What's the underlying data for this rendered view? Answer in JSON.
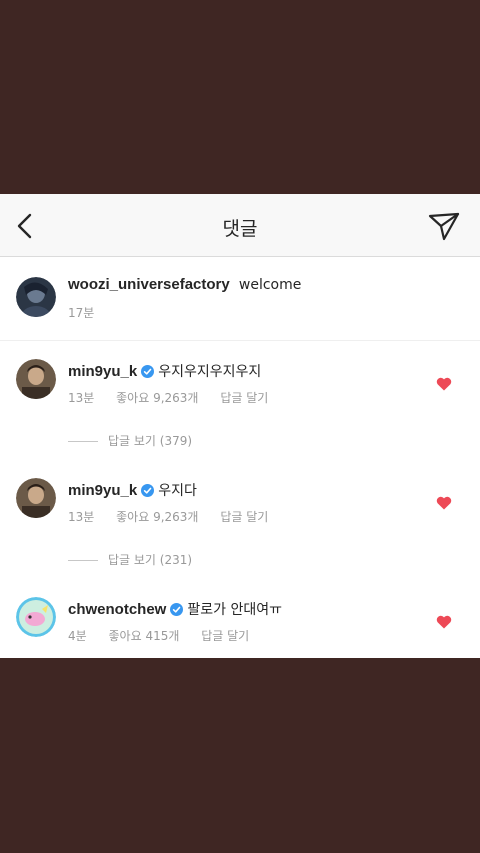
{
  "header": {
    "title": "댓글"
  },
  "caption": {
    "username": "woozi_universefactory",
    "text": "welcome",
    "time": "17분"
  },
  "comments": [
    {
      "username": "min9yu_k",
      "verified": true,
      "text": "우지우지우지우지",
      "time": "13분",
      "likes": "좋아요 9,263개",
      "reply_label": "답글 달기",
      "view_replies": "답글 보기 (379)"
    },
    {
      "username": "min9yu_k",
      "verified": true,
      "text": "우지다",
      "time": "13분",
      "likes": "좋아요 9,263개",
      "reply_label": "답글 달기",
      "view_replies": "답글 보기 (231)"
    },
    {
      "username": "chwenotchew",
      "verified": true,
      "text": "팔로가 안대여ㅠ",
      "time": "4분",
      "likes": "좋아요 415개",
      "reply_label": "답글 달기"
    }
  ],
  "colors": {
    "background": "#3f2623",
    "heart": "#ed4956",
    "verified": "#3897f0",
    "muted": "#999999"
  },
  "icons": [
    "back-icon",
    "send-icon",
    "verified-icon",
    "heart-icon"
  ]
}
